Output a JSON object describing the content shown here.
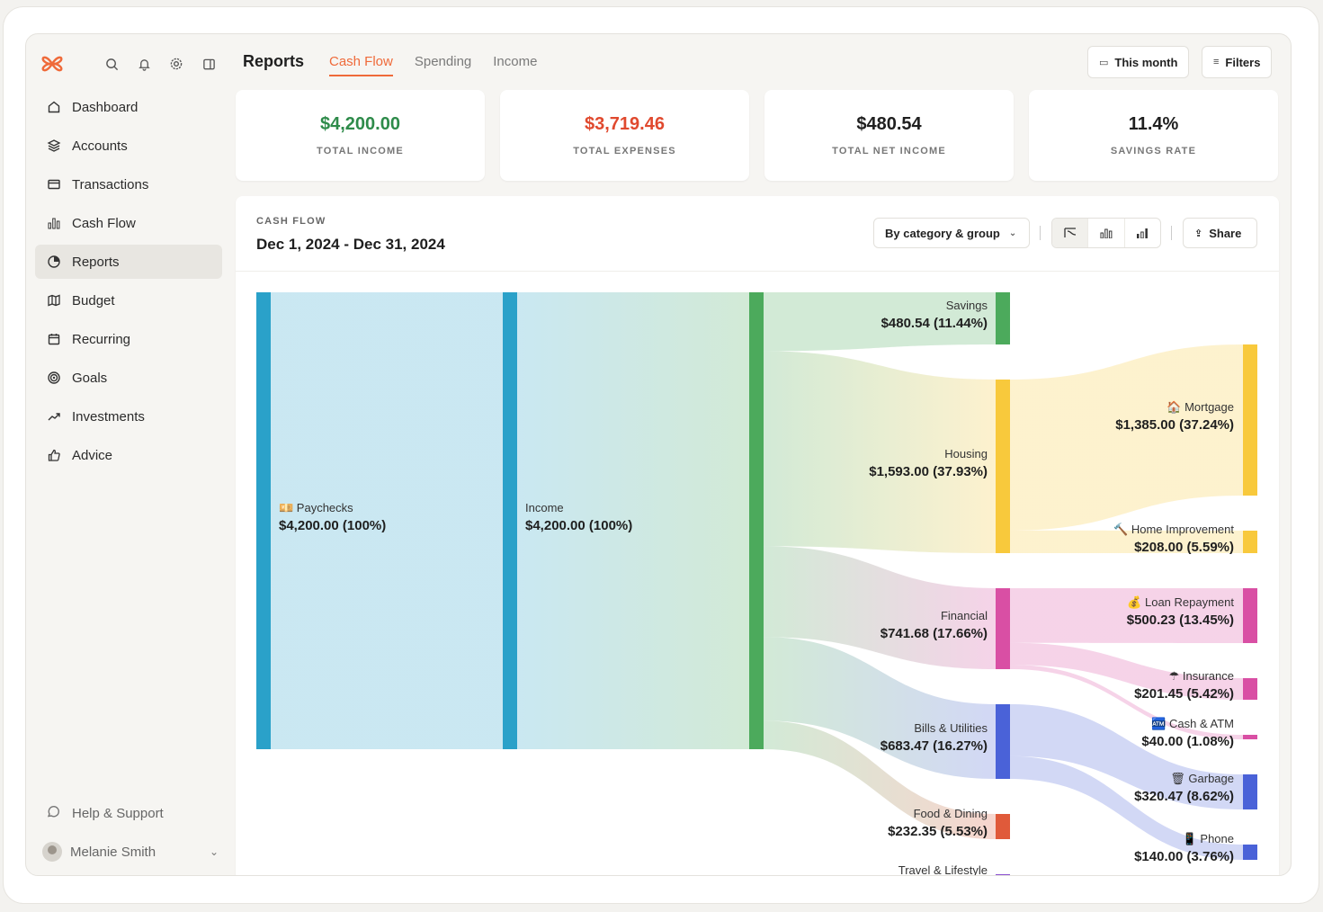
{
  "sidebar": {
    "nav": [
      {
        "label": "Dashboard",
        "icon": "home-icon"
      },
      {
        "label": "Accounts",
        "icon": "layers-icon"
      },
      {
        "label": "Transactions",
        "icon": "card-icon"
      },
      {
        "label": "Cash Flow",
        "icon": "bar-chart-icon"
      },
      {
        "label": "Reports",
        "icon": "pie-icon",
        "active": true
      },
      {
        "label": "Budget",
        "icon": "map-icon"
      },
      {
        "label": "Recurring",
        "icon": "calendar-icon"
      },
      {
        "label": "Goals",
        "icon": "target-icon"
      },
      {
        "label": "Investments",
        "icon": "trend-icon"
      },
      {
        "label": "Advice",
        "icon": "thumbs-up-icon"
      }
    ],
    "help": "Help & Support",
    "user": "Melanie Smith"
  },
  "header": {
    "title": "Reports",
    "tabs": [
      "Cash Flow",
      "Spending",
      "Income"
    ],
    "active_tab": "Cash Flow",
    "this_month": "This month",
    "filters": "Filters"
  },
  "kpis": [
    {
      "value": "$4,200.00",
      "label": "TOTAL INCOME",
      "color": "#2e8b4a"
    },
    {
      "value": "$3,719.46",
      "label": "TOTAL EXPENSES",
      "color": "#e0492e"
    },
    {
      "value": "$480.54",
      "label": "TOTAL NET INCOME",
      "color": "#1f1f1f"
    },
    {
      "value": "11.4%",
      "label": "SAVINGS RATE",
      "color": "#1f1f1f"
    }
  ],
  "main": {
    "eyebrow": "CASH FLOW",
    "date_range": "Dec 1, 2024 - Dec 31, 2024",
    "group_by": "By category & group",
    "share": "Share"
  },
  "chart_data": {
    "type": "sankey",
    "nodes": [
      {
        "id": "paychecks",
        "name": "💴 Paychecks",
        "value": "$4,200.00 (100%)",
        "color": "#2aa1c9"
      },
      {
        "id": "income",
        "name": "Income",
        "value": "$4,200.00 (100%)",
        "color": "#2aa1c9"
      },
      {
        "id": "budget",
        "name": "",
        "value": "",
        "color": "#4caa5c"
      },
      {
        "id": "savings",
        "name": "Savings",
        "value": "$480.54 (11.44%)",
        "color": "#4caa5c"
      },
      {
        "id": "housing",
        "name": "Housing",
        "value": "$1,593.00 (37.93%)",
        "color": "#f8c93c"
      },
      {
        "id": "financial",
        "name": "Financial",
        "value": "$741.68 (17.66%)",
        "color": "#d94fa4"
      },
      {
        "id": "bills",
        "name": "Bills & Utilities",
        "value": "$683.47 (16.27%)",
        "color": "#4a62d8"
      },
      {
        "id": "food",
        "name": "Food & Dining",
        "value": "$232.35 (5.53%)",
        "color": "#e05a3a"
      },
      {
        "id": "travel",
        "name": "Travel & Lifestyle",
        "value": "",
        "color": "#8a4fd0"
      },
      {
        "id": "mortgage",
        "name": "🏠 Mortgage",
        "value": "$1,385.00 (37.24%)",
        "color": "#f8c93c"
      },
      {
        "id": "homeimp",
        "name": "🔨 Home Improvement",
        "value": "$208.00 (5.59%)",
        "color": "#f8c93c"
      },
      {
        "id": "loan",
        "name": "💰 Loan Repayment",
        "value": "$500.23 (13.45%)",
        "color": "#d94fa4"
      },
      {
        "id": "insurance",
        "name": "☂ Insurance",
        "value": "$201.45 (5.42%)",
        "color": "#d94fa4"
      },
      {
        "id": "cashatm",
        "name": "🏧 Cash & ATM",
        "value": "$40.00 (1.08%)",
        "color": "#d94fa4"
      },
      {
        "id": "garbage",
        "name": "🗑 Garbage",
        "value": "$320.47 (8.62%)",
        "color": "#4a62d8"
      },
      {
        "id": "phone",
        "name": "📱 Phone",
        "value": "$140.00 (3.76%)",
        "color": "#4a62d8"
      }
    ],
    "links": [
      {
        "source": "paychecks",
        "target": "income",
        "value": 4200.0
      },
      {
        "source": "income",
        "target": "budget",
        "value": 4200.0
      },
      {
        "source": "budget",
        "target": "savings",
        "value": 480.54
      },
      {
        "source": "budget",
        "target": "housing",
        "value": 1593.0
      },
      {
        "source": "budget",
        "target": "financial",
        "value": 741.68
      },
      {
        "source": "budget",
        "target": "bills",
        "value": 683.47
      },
      {
        "source": "budget",
        "target": "food",
        "value": 232.35
      },
      {
        "source": "housing",
        "target": "mortgage",
        "value": 1385.0
      },
      {
        "source": "housing",
        "target": "homeimp",
        "value": 208.0
      },
      {
        "source": "financial",
        "target": "loan",
        "value": 500.23
      },
      {
        "source": "financial",
        "target": "insurance",
        "value": 201.45
      },
      {
        "source": "financial",
        "target": "cashatm",
        "value": 40.0
      },
      {
        "source": "bills",
        "target": "garbage",
        "value": 320.47
      },
      {
        "source": "bills",
        "target": "phone",
        "value": 140.0
      }
    ]
  }
}
